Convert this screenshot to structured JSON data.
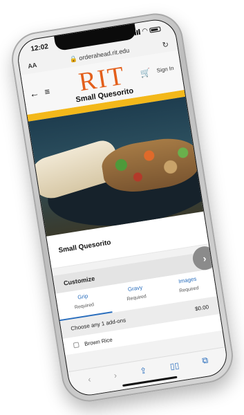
{
  "status": {
    "time": "12:02"
  },
  "browser": {
    "text_size": "AA",
    "url": "orderahead.rit.edu"
  },
  "header": {
    "logo": "RIT",
    "signin_label": "Sign In",
    "page_title": "Small Quesorito"
  },
  "item": {
    "name": "Small Quesorito"
  },
  "customize": {
    "label": "Customize",
    "tabs": [
      {
        "label": "Grip",
        "status": "Required"
      },
      {
        "label": "Gravy",
        "status": "Required"
      },
      {
        "label": "Images",
        "status": "Required"
      }
    ],
    "addon_prompt": "Choose any 1 add-ons",
    "addon_price": "$0.00",
    "options": [
      {
        "label": "Brown Rice"
      }
    ]
  },
  "colors": {
    "rit_orange": "#e35f1b",
    "rit_gold": "#f3b81a",
    "link_blue": "#2a6ebd"
  },
  "icons": [
    "back-arrow-icon",
    "menu-icon",
    "cart-icon",
    "share-icon",
    "bookmarks-icon",
    "tabs-icon",
    "reload-icon"
  ]
}
